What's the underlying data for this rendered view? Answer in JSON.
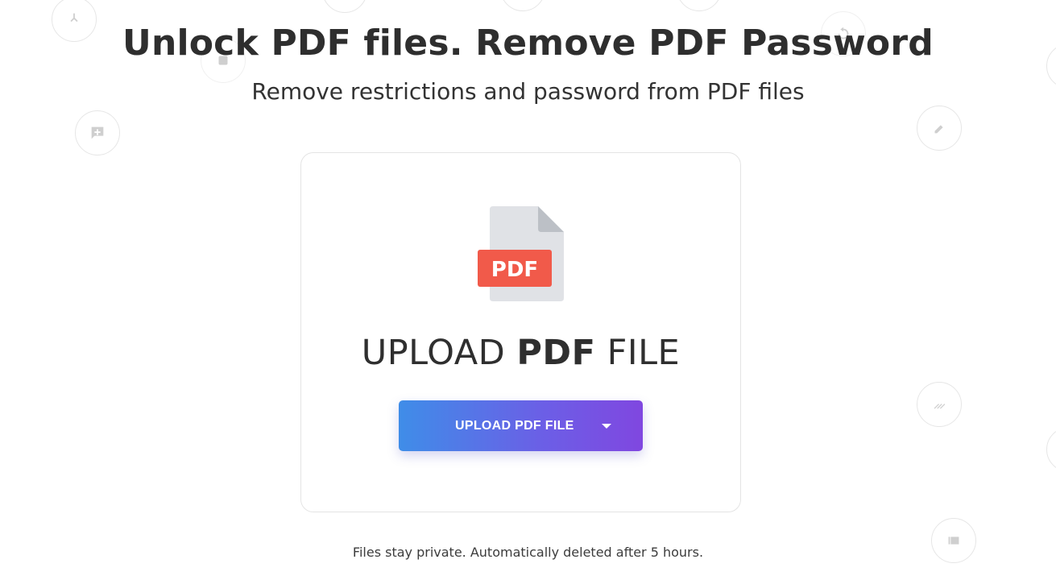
{
  "header": {
    "title": "Unlock PDF files. Remove PDF Password",
    "subtitle": "Remove restrictions and password from PDF files"
  },
  "upload_card": {
    "file_badge": "PDF",
    "heading_prefix": "UPLOAD ",
    "heading_bold": "PDF",
    "heading_suffix": " FILE",
    "button_label": "UPLOAD PDF FILE"
  },
  "footer": {
    "privacy_note": "Files stay private. Automatically deleted after 5 hours."
  },
  "colors": {
    "badge_red": "#f15a4a",
    "button_gradient_start": "#3f8de8",
    "button_gradient_end": "#8047e0"
  },
  "background_icons": [
    "merge-icon",
    "compress-icon",
    "add-comment-icon",
    "rotate-icon",
    "edit-icon",
    "shapes-icon",
    "stripes-icon",
    "gallery-icon"
  ]
}
